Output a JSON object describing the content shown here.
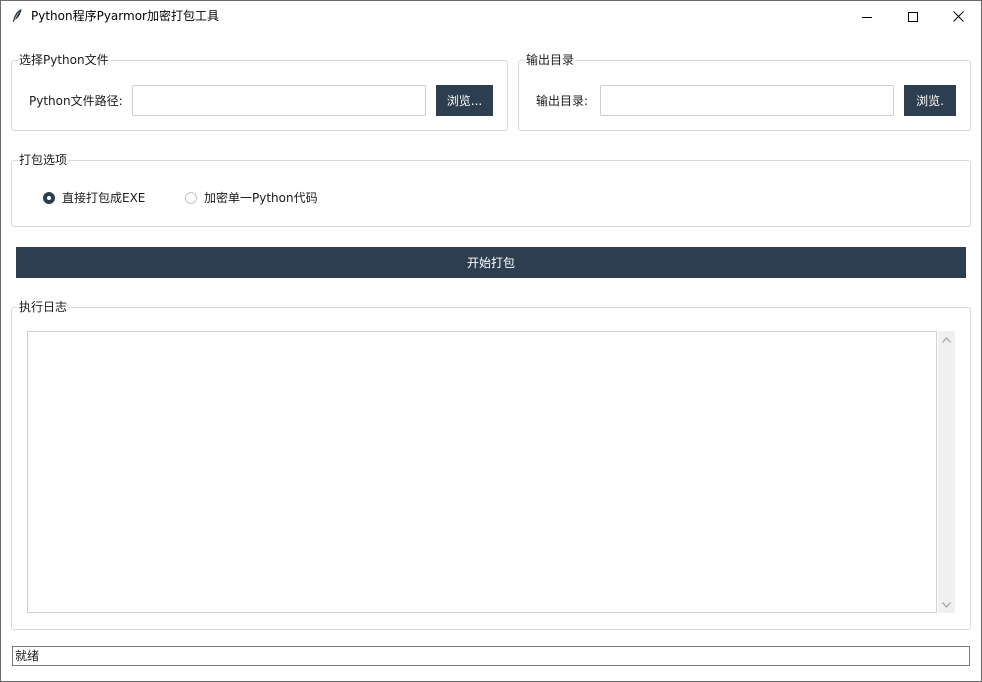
{
  "window": {
    "title": "Python程序Pyarmor加密打包工具",
    "icon": "feather-icon"
  },
  "file_group": {
    "title": "选择Python文件",
    "label": "Python文件路径:",
    "value": "",
    "placeholder": "",
    "browse_label": "浏览..."
  },
  "output_group": {
    "title": "输出目录",
    "label": "输出目录:",
    "value": "",
    "placeholder": "",
    "browse_label": "浏览."
  },
  "options_group": {
    "title": "打包选项",
    "options": [
      {
        "label": "直接打包成EXE",
        "selected": true
      },
      {
        "label": "加密单一Python代码",
        "selected": false
      }
    ]
  },
  "start_button": {
    "label": "开始打包"
  },
  "log_group": {
    "title": "执行日志",
    "content": ""
  },
  "status": {
    "text": "就绪"
  },
  "colors": {
    "accent": "#2c3e50",
    "border": "#d9d9d9",
    "scrollbar_track": "#f0f0f0"
  }
}
